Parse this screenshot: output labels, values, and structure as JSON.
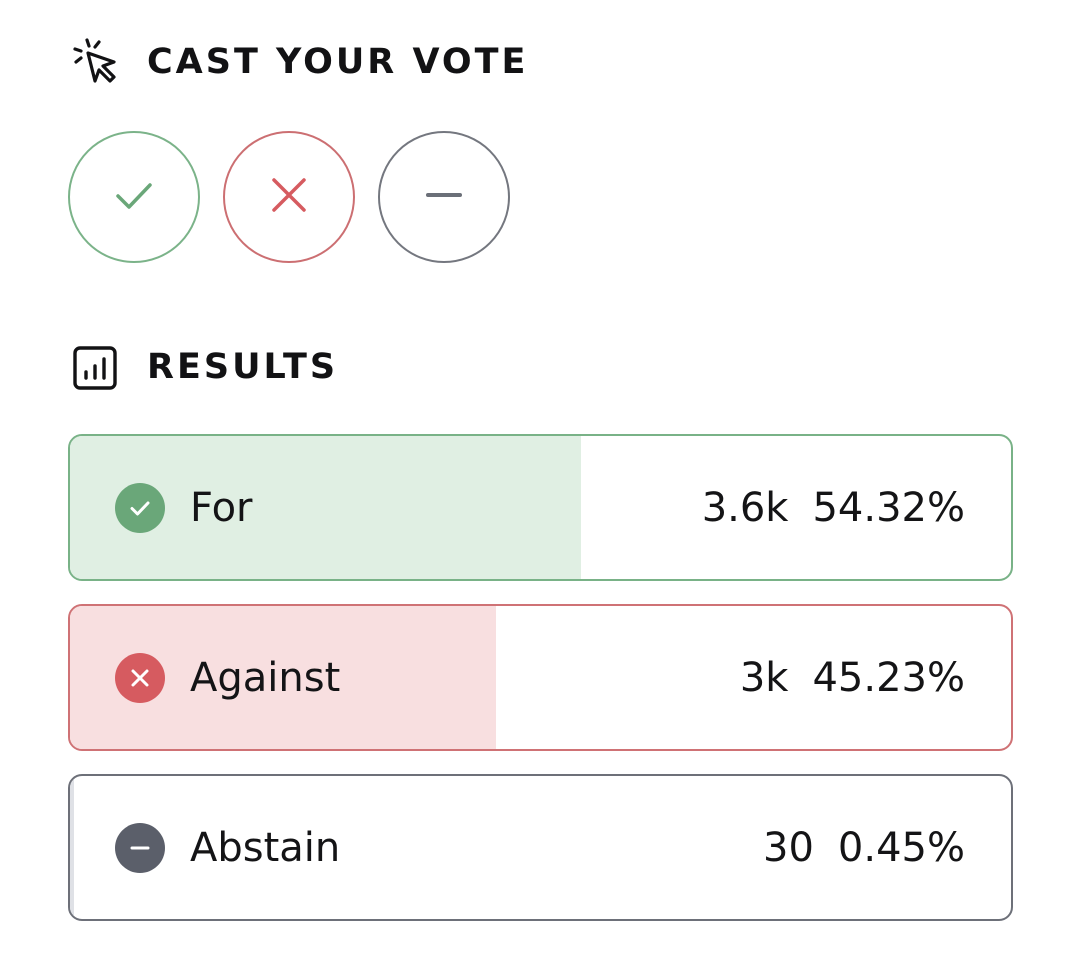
{
  "vote": {
    "title": "CAST YOUR VOTE",
    "icon": "cursor-click-icon",
    "buttons": [
      {
        "id": "for",
        "icon": "check-icon",
        "color": "#6aa779"
      },
      {
        "id": "against",
        "icon": "x-icon",
        "color": "#d65b60"
      },
      {
        "id": "abstain",
        "icon": "minus-icon",
        "color": "#6b6f78"
      }
    ]
  },
  "results": {
    "title": "RESULTS",
    "icon": "bar-chart-icon",
    "rows": [
      {
        "label": "For",
        "count": "3.6k",
        "percent": "54.32%",
        "share": 0.5432,
        "color": "#6aa779",
        "icon": "check-circle-icon"
      },
      {
        "label": "Against",
        "count": "3k",
        "percent": "45.23%",
        "share": 0.4523,
        "color": "#d65b60",
        "icon": "x-circle-icon"
      },
      {
        "label": "Abstain",
        "count": "30",
        "percent": "0.45%",
        "share": 0.0045,
        "color": "#5b5f6a",
        "icon": "minus-circle-icon"
      }
    ]
  }
}
